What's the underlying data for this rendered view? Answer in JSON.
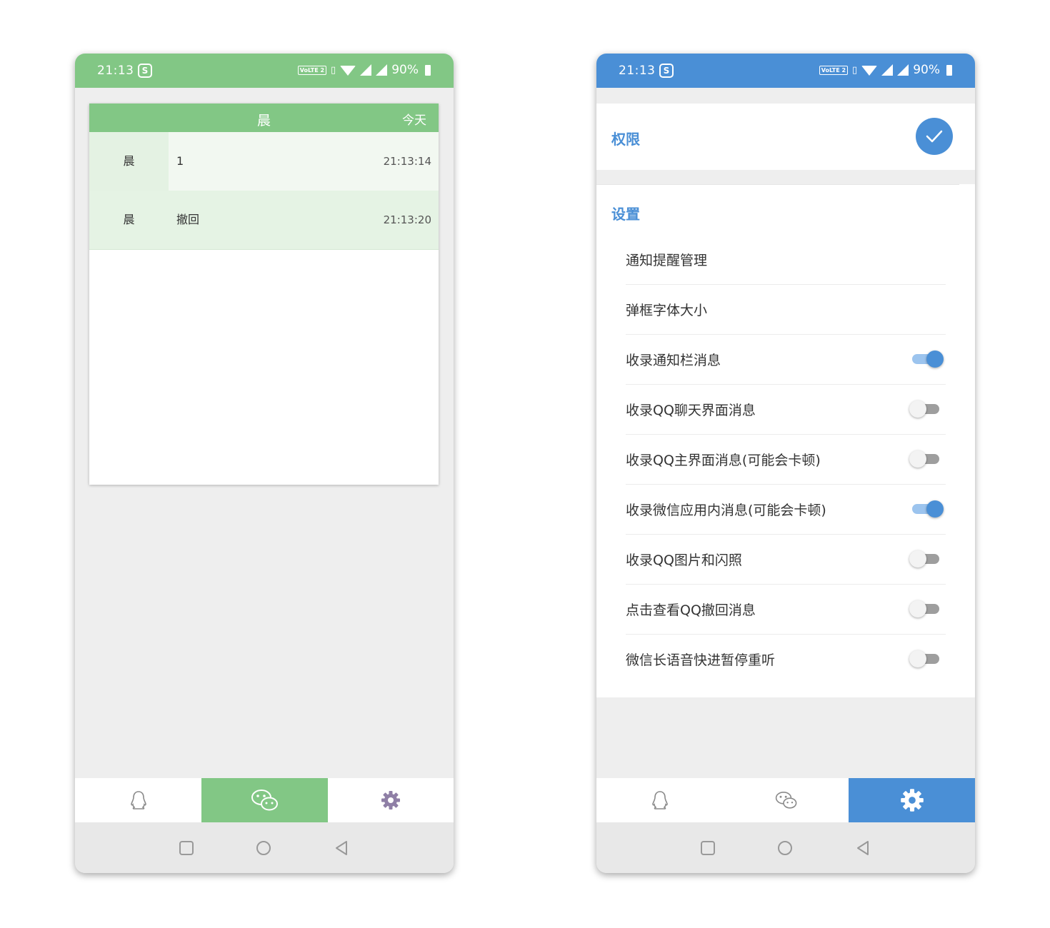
{
  "status_bar": {
    "time": "21:13",
    "volte": "VoLTE 2",
    "battery": "90%"
  },
  "left_screen": {
    "card_title": "晨",
    "card_today": "今天",
    "messages": [
      {
        "sender": "晨",
        "content": "1",
        "time": "21:13:14"
      },
      {
        "sender": "晨",
        "content": "撤回",
        "time": "21:13:20"
      }
    ],
    "active_tab": "wechat",
    "accent_color": "#82c785"
  },
  "right_screen": {
    "permission_title": "权限",
    "settings_title": "设置",
    "settings": [
      {
        "label": "通知提醒管理",
        "toggle": null
      },
      {
        "label": "弹框字体大小",
        "toggle": null
      },
      {
        "label": "收录通知栏消息",
        "toggle": true
      },
      {
        "label": "收录QQ聊天界面消息",
        "toggle": false
      },
      {
        "label": "收录QQ主界面消息(可能会卡顿)",
        "toggle": false
      },
      {
        "label": "收录微信应用内消息(可能会卡顿)",
        "toggle": true
      },
      {
        "label": "收录QQ图片和闪照",
        "toggle": false
      },
      {
        "label": "点击查看QQ撤回消息",
        "toggle": false
      },
      {
        "label": "微信长语音快进暂停重听",
        "toggle": false
      }
    ],
    "active_tab": "settings",
    "accent_color": "#4a8fd6"
  },
  "nav_icons": [
    "qq-icon",
    "wechat-icon",
    "gear-icon"
  ],
  "system_nav_icons": [
    "recents-square-icon",
    "home-circle-icon",
    "back-triangle-icon"
  ]
}
